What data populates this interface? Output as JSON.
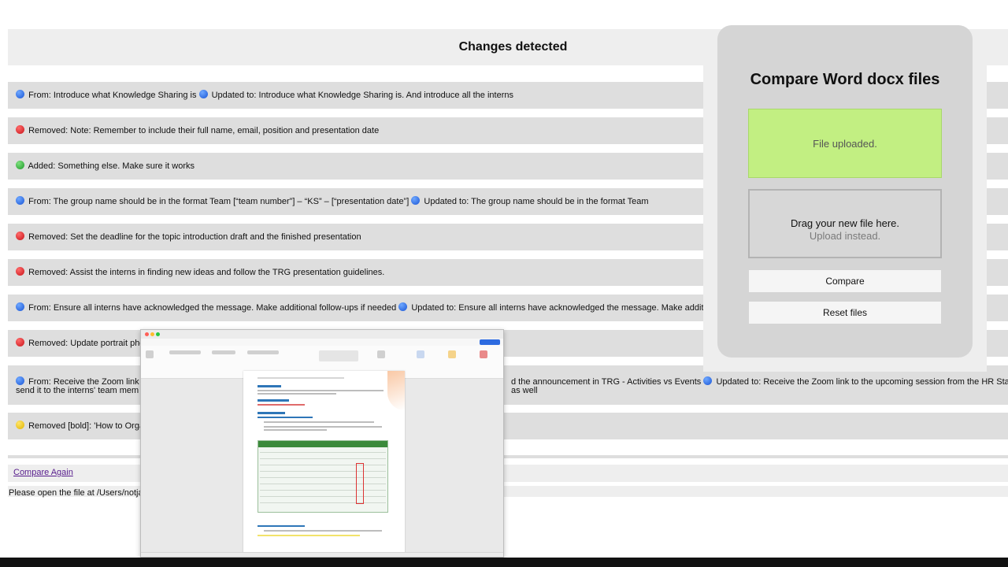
{
  "header": {
    "title": "Changes detected"
  },
  "changes": [
    {
      "status": "blue",
      "text": "From: Introduce what Knowledge Sharing is",
      "status2": "blue",
      "text2": "Updated to: Introduce what Knowledge Sharing is. And introduce all the interns"
    },
    {
      "status": "red",
      "text": "Removed: Note: Remember to include their full name, email, position and presentation date"
    },
    {
      "status": "green",
      "text": "Added: Something else. Make sure it works"
    },
    {
      "status": "blue",
      "text": "From: The group name should be in the format Team [“team number”] – “KS” – [“presentation date”]",
      "status2": "blue",
      "text2": "Updated to: The group name should be in the format Team"
    },
    {
      "status": "red",
      "text": "Removed: Set the deadline for the topic introduction draft and the finished presentation"
    },
    {
      "status": "red",
      "text": "Removed: Assist the interns in finding new ideas and follow the TRG presentation guidelines."
    },
    {
      "status": "blue",
      "text": "From: Ensure all interns have acknowledged the message. Make additional follow-ups if needed",
      "status2": "blue",
      "text2": "Updated to: Ensure all interns have acknowledged the message. Make additi"
    },
    {
      "status": "red",
      "text": "Removed: Update portrait pho"
    },
    {
      "status": "blue",
      "text": "From: Receive the Zoom link t",
      "text_mid": "d the announcement in TRG - Activities vs Events",
      "status2": "blue",
      "text2": "Updated to: Receive the Zoom link to the upcoming session from the HR Staff,",
      "text3": "send it to the interns' team mem",
      "text4": "as well"
    },
    {
      "status": "yellow",
      "text": "Removed [bold]: 'How to Orga"
    }
  ],
  "footer": {
    "compare_again": "Compare Again",
    "open_note": "Please open the file at /Users/notja"
  },
  "panel": {
    "title": "Compare Word docx files",
    "uploaded_text": "File uploaded.",
    "drop_main": "Drag your new file here.",
    "drop_sub": "Upload instead.",
    "compare_label": "Compare",
    "reset_label": "Reset files"
  },
  "colors": {
    "blue": "#1a56d6",
    "red": "#c8141a",
    "green": "#1e9a2a",
    "yellow": "#e0b400",
    "uploaded_bg": "#c2ef82",
    "link": "#551a8b"
  },
  "icons": {
    "status": "status-dot-icon"
  }
}
